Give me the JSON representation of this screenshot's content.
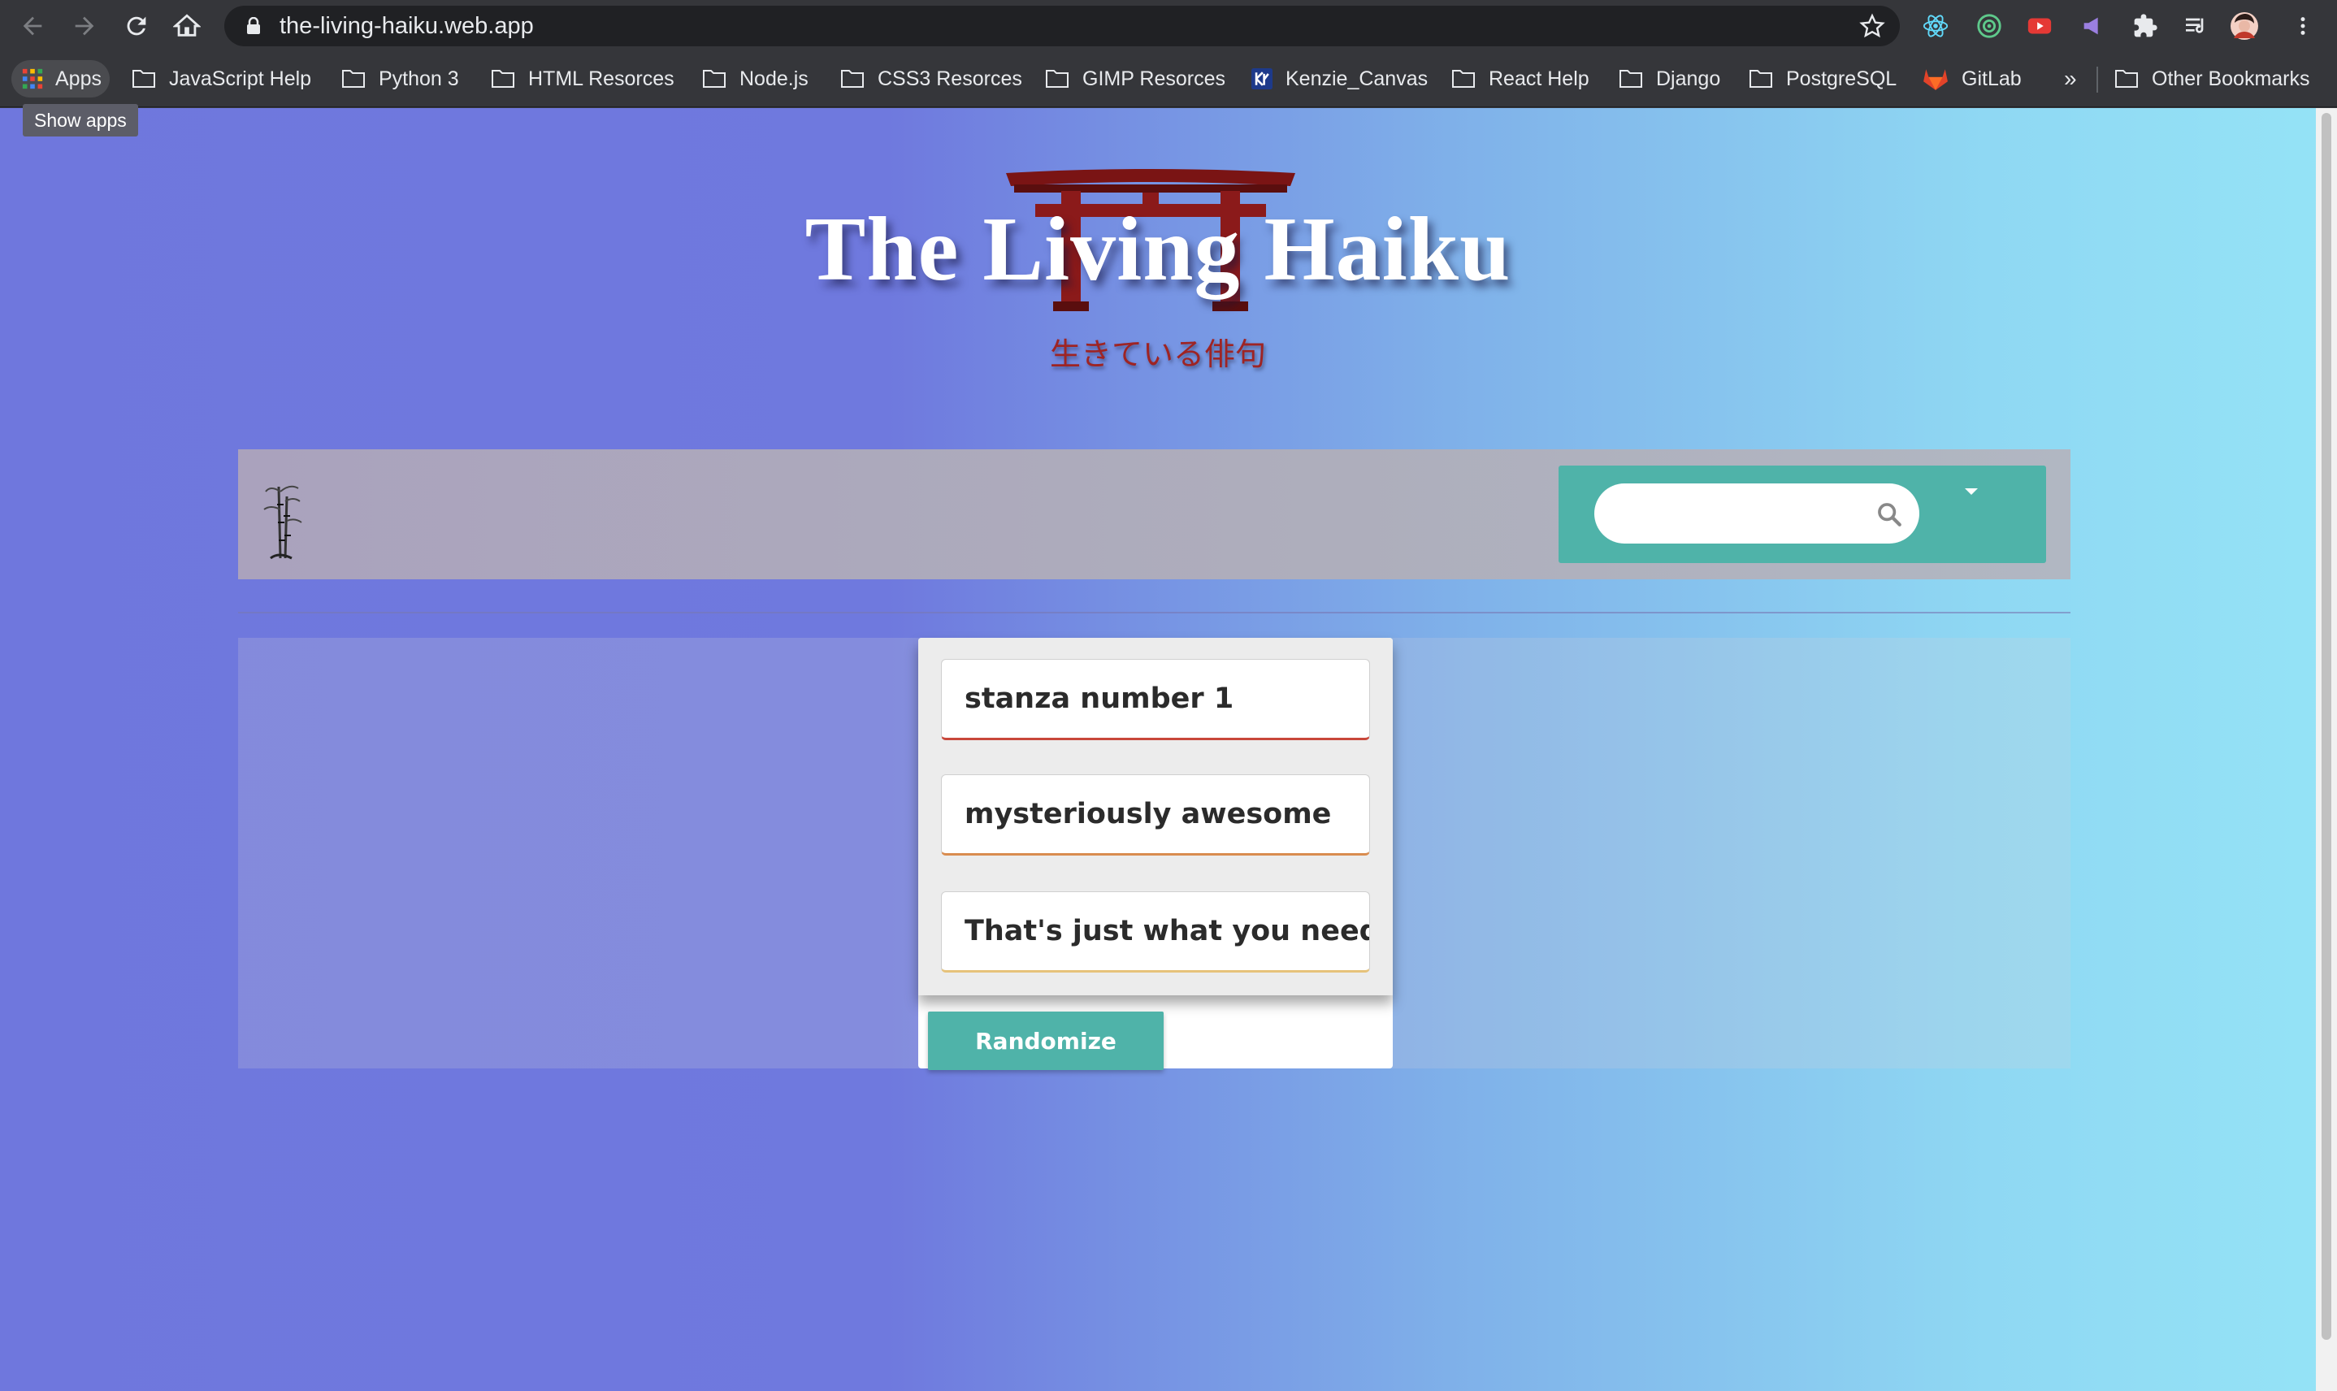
{
  "browser": {
    "url": "the-living-haiku.web.app",
    "bookmarks": [
      {
        "label": "Apps",
        "icon": "apps-grid-icon"
      },
      {
        "label": "JavaScript Help",
        "icon": "folder-icon"
      },
      {
        "label": "Python 3",
        "icon": "folder-icon"
      },
      {
        "label": "HTML Resorces",
        "icon": "folder-icon"
      },
      {
        "label": "Node.js",
        "icon": "folder-icon"
      },
      {
        "label": "CSS3 Resorces",
        "icon": "folder-icon"
      },
      {
        "label": "GIMP Resorces",
        "icon": "folder-icon"
      },
      {
        "label": "Kenzie_Canvas",
        "icon": "kenzie-logo-icon"
      },
      {
        "label": "React Help",
        "icon": "folder-icon"
      },
      {
        "label": "Django",
        "icon": "folder-icon"
      },
      {
        "label": "PostgreSQL",
        "icon": "folder-icon"
      },
      {
        "label": "GitLab",
        "icon": "gitlab-icon"
      }
    ],
    "overflow_label": "»",
    "other_bookmarks": "Other Bookmarks",
    "tooltip": "Show apps"
  },
  "header": {
    "title": "The Living Haiku",
    "subtitle": "生きている俳句"
  },
  "haiku": {
    "stanza_1": "stanza number 1",
    "stanza_2": "mysteriously awesome",
    "stanza_3": "That's just what you need",
    "randomize_label": "Randomize"
  },
  "colors": {
    "accent_teal": "#4fb3a9",
    "torii_red": "#8b1a1a",
    "subtitle_red": "#9e2424",
    "gradient_left": "#6f77dd",
    "gradient_right": "#95e3f6"
  }
}
